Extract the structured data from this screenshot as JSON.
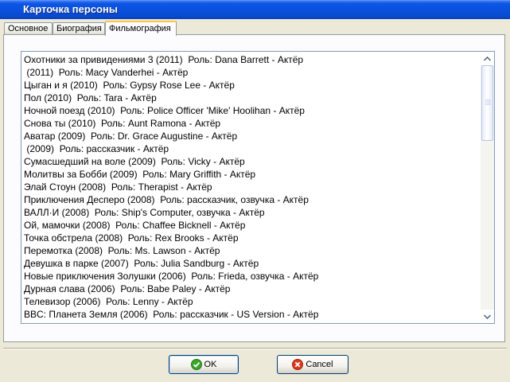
{
  "window": {
    "title": "Карточка персоны"
  },
  "tabs": [
    {
      "label": "Основное"
    },
    {
      "label": "Биография"
    },
    {
      "label": "Фильмография",
      "active": true
    }
  ],
  "filmography": [
    "Охотники за привидениями 3 (2011)  Роль: Dana Barrett - Актёр",
    " (2011)  Роль: Macy Vanderhei - Актёр",
    "Цыган и я (2010)  Роль: Gypsy Rose Lee - Актёр",
    "Пол (2010)  Роль: Tara - Актёр",
    "Ночной поезд (2010)  Роль: Police Officer 'Mike' Hoolihan - Актёр",
    "Снова ты (2010)  Роль: Aunt Ramona - Актёр",
    "Аватар (2009)  Роль: Dr. Grace Augustine - Актёр",
    " (2009)  Роль: рассказчик - Актёр",
    "Сумасшедший на воле (2009)  Роль: Vicky - Актёр",
    "Молитвы за Бобби (2009)  Роль: Mary Griffith - Актёр",
    "Элай Стоун (2008)  Роль: Therapist - Актёр",
    "Приключения Десперо (2008)  Роль: рассказчик, озвучка - Актёр",
    "ВАЛЛ·И (2008)  Роль: Ship's Computer, озвучка - Актёр",
    "Ой, мамочки (2008)  Роль: Chaffee Bicknell - Актёр",
    "Точка обстрела (2008)  Роль: Rex Brooks - Актёр",
    "Перемотка (2008)  Роль: Ms. Lawson - Актёр",
    "Девушка в парке (2007)  Роль: Julia Sandburg - Актёр",
    "Новые приключения Золушки (2006)  Роль: Frieda, озвучка - Актёр",
    "Дурная слава (2006)  Роль: Babe Paley - Актёр",
    "Телевизор (2006)  Роль: Lenny - Актёр",
    "BBC: Планета Земля (2006)  Роль: рассказчик - US Version - Актёр"
  ],
  "buttons": {
    "ok": "OK",
    "cancel": "Cancel"
  },
  "icons": {
    "ok": "check-circle-icon",
    "cancel": "x-circle-icon",
    "scroll_up": "arrow-up-icon",
    "scroll_down": "arrow-down-icon"
  },
  "colors": {
    "titlebar": "#0a4fda",
    "ok_icon": "#3aa52a",
    "cancel_icon": "#d83a1e"
  }
}
